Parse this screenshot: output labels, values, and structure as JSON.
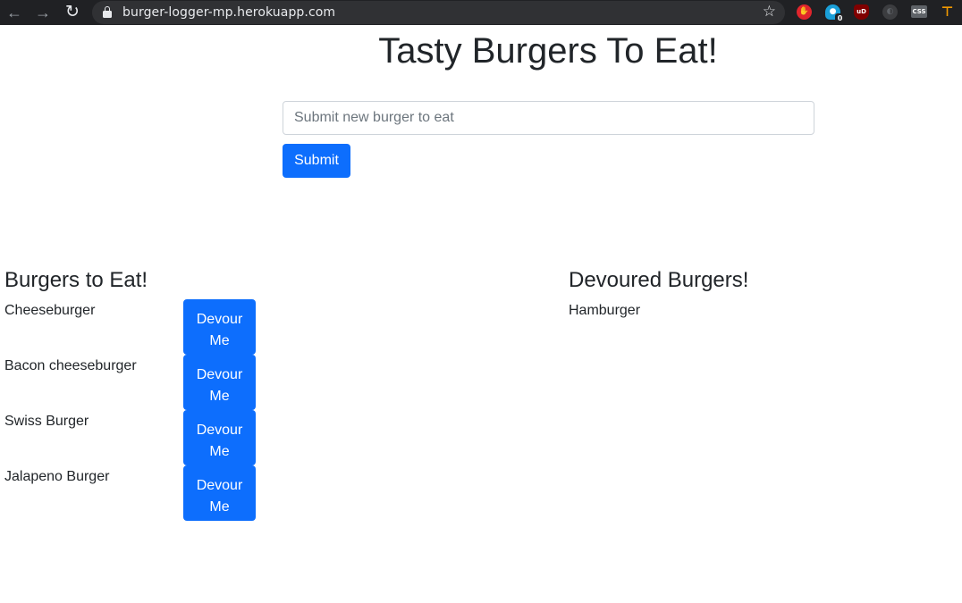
{
  "browser": {
    "url": "burger-logger-mp.herokuapp.com",
    "extension_badge": "0"
  },
  "page": {
    "title": "Tasty Burgers To Eat!",
    "input_placeholder": "Submit new burger to eat",
    "submit_label": "Submit"
  },
  "to_eat": {
    "heading": "Burgers to Eat!",
    "devour_label_line1": "Devour",
    "devour_label_line2": "Me",
    "items": [
      {
        "name": "Cheeseburger"
      },
      {
        "name": "Bacon cheeseburger"
      },
      {
        "name": "Swiss Burger"
      },
      {
        "name": "Jalapeno Burger"
      }
    ]
  },
  "devoured": {
    "heading": "Devoured Burgers!",
    "items": [
      {
        "name": "Hamburger"
      }
    ]
  },
  "colors": {
    "primary": "#0d6efd",
    "text": "#212529",
    "chrome_bg": "#202124"
  }
}
